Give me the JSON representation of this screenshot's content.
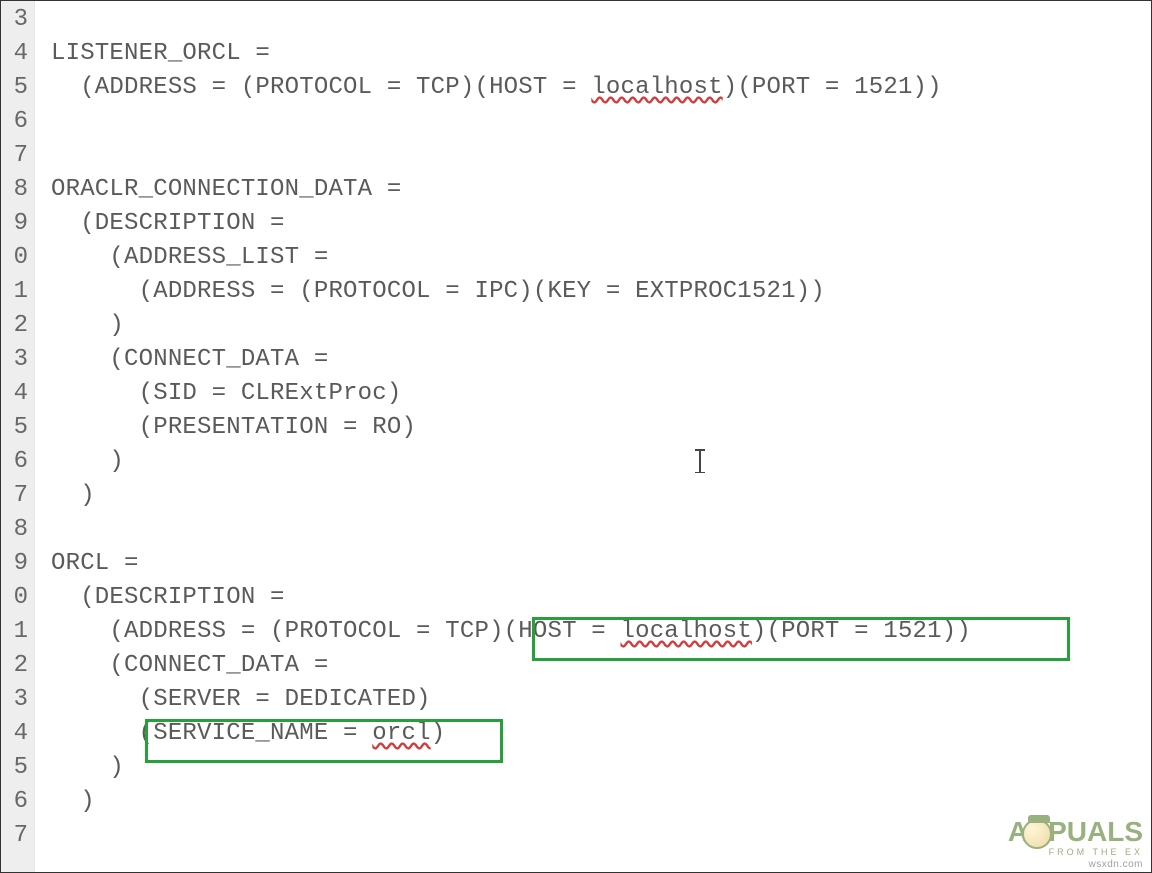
{
  "gutter": {
    "lines": [
      "3",
      "4",
      "5",
      "6",
      "7",
      "8",
      "9",
      "0",
      "1",
      "2",
      "3",
      "4",
      "5",
      "6",
      "7",
      "8",
      "9",
      "0",
      "1",
      "2",
      "3",
      "4",
      "5",
      "6",
      "7"
    ]
  },
  "code": {
    "l3": "",
    "l4": "LISTENER_ORCL =",
    "l5a": "  (ADDRESS = (PROTOCOL = TCP)(HOST = ",
    "l5b": "localhost",
    "l5c": ")(PORT = 1521))",
    "l6": "",
    "l7": "",
    "l8": "ORACLR_CONNECTION_DATA =",
    "l9": "  (DESCRIPTION =",
    "l10": "    (ADDRESS_LIST =",
    "l11": "      (ADDRESS = (PROTOCOL = IPC)(KEY = EXTPROC1521))",
    "l12": "    )",
    "l13": "    (CONNECT_DATA =",
    "l14": "      (SID = CLRExtProc)",
    "l15": "      (PRESENTATION = RO)",
    "l16": "    )",
    "l17": "  )",
    "l18": "",
    "l19": "ORCL =",
    "l20": "  (DESCRIPTION =",
    "l21a": "    (ADDRESS = (PROTOCOL = TCP)(HOST = ",
    "l21b": "localhost",
    "l21c": ")(PORT = 1521))",
    "l22": "    (CONNECT_DATA =",
    "l23": "      (SERVER = DEDICATED)",
    "l24a": "      (SERVICE_NAME = ",
    "l24b": "orcl",
    "l24c": ")",
    "l25": "    )",
    "l26": "  )",
    "l27": ""
  },
  "watermark": {
    "brand_left": "A",
    "brand_right": "PUALS",
    "tagline": "FROM  THE  EX",
    "site": "wsxdn.com"
  }
}
